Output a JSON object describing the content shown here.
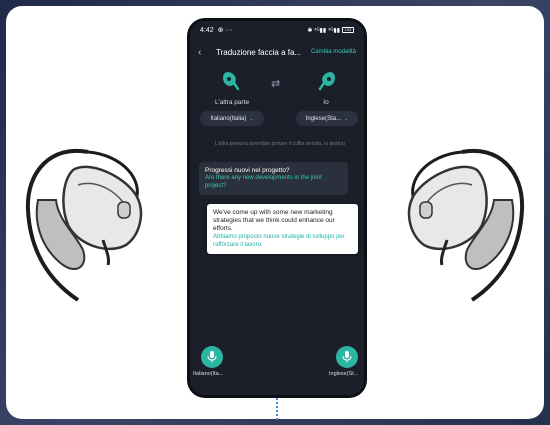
{
  "status_bar": {
    "time": "4:42",
    "extras": "⊕ ···",
    "right": "✱ ⁴ᴳ▮▮ ⁴ᴳ▮▮",
    "battery": "100"
  },
  "nav": {
    "title": "Traduzione faccia a fa...",
    "switch_mode": "Cambia modalità"
  },
  "devices": {
    "left_label": "L'altra parte",
    "right_label": "Io"
  },
  "languages": {
    "left": "Italiano(Italia)",
    "right": "Inglese(Sta..."
  },
  "hint": "L'altra persona dovrebbe portare il cuffia sinistra, io destra)",
  "messages": [
    {
      "source": "Progressi nuovi nel progetto?",
      "translation": "Are there any new developments in the joint project?"
    },
    {
      "source": "We've come up with some new marketing strategies that we think could enhance our efforts.",
      "translation": "Abbiamo proposto nuove strategie di sviluppo per rafforzare il lavoro."
    }
  ],
  "mics": {
    "left_label": "Italiano(Ita...",
    "right_label": "Inglese(St..."
  },
  "colors": {
    "accent": "#35c9b6",
    "screen_bg": "#1b1f2a",
    "indicator": "#3a8be0"
  },
  "icons": [
    "back-icon",
    "swap-icon",
    "earbud-icon",
    "microphone-icon",
    "chevron-down-icon"
  ]
}
